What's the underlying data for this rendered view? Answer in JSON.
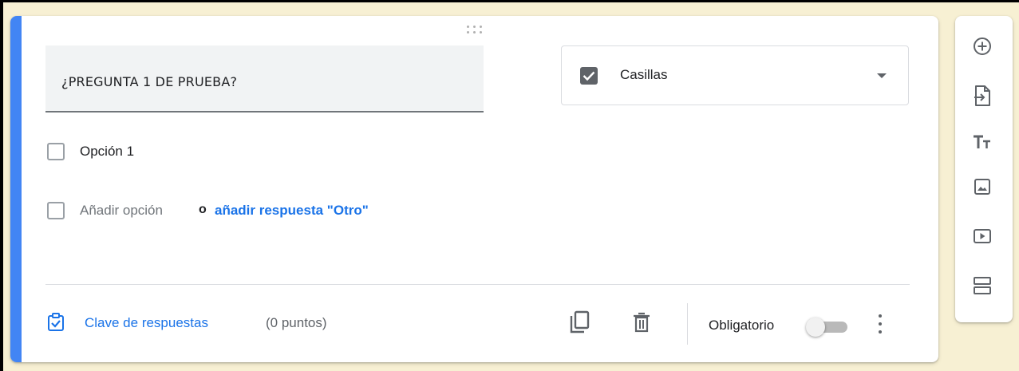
{
  "question": {
    "title": "¿PREGUNTA 1 DE PRUEBA?",
    "type_selected": "Casillas",
    "options": [
      {
        "label": "Opción 1"
      }
    ],
    "add_option_placeholder": "Añadir opción",
    "or_text": "o",
    "add_other_link": "añadir respuesta \"Otro\""
  },
  "footer": {
    "answer_key_label": "Clave de respuestas",
    "points_label": "(0 puntos)",
    "required_label": "Obligatorio",
    "required_on": false
  },
  "toolbar": {
    "items": [
      "add-question-icon",
      "import-questions-icon",
      "add-title-icon",
      "add-image-icon",
      "add-video-icon",
      "add-section-icon"
    ]
  },
  "colors": {
    "accent": "#4285f4",
    "link": "#1a73e8",
    "background": "#f7f0d3"
  }
}
